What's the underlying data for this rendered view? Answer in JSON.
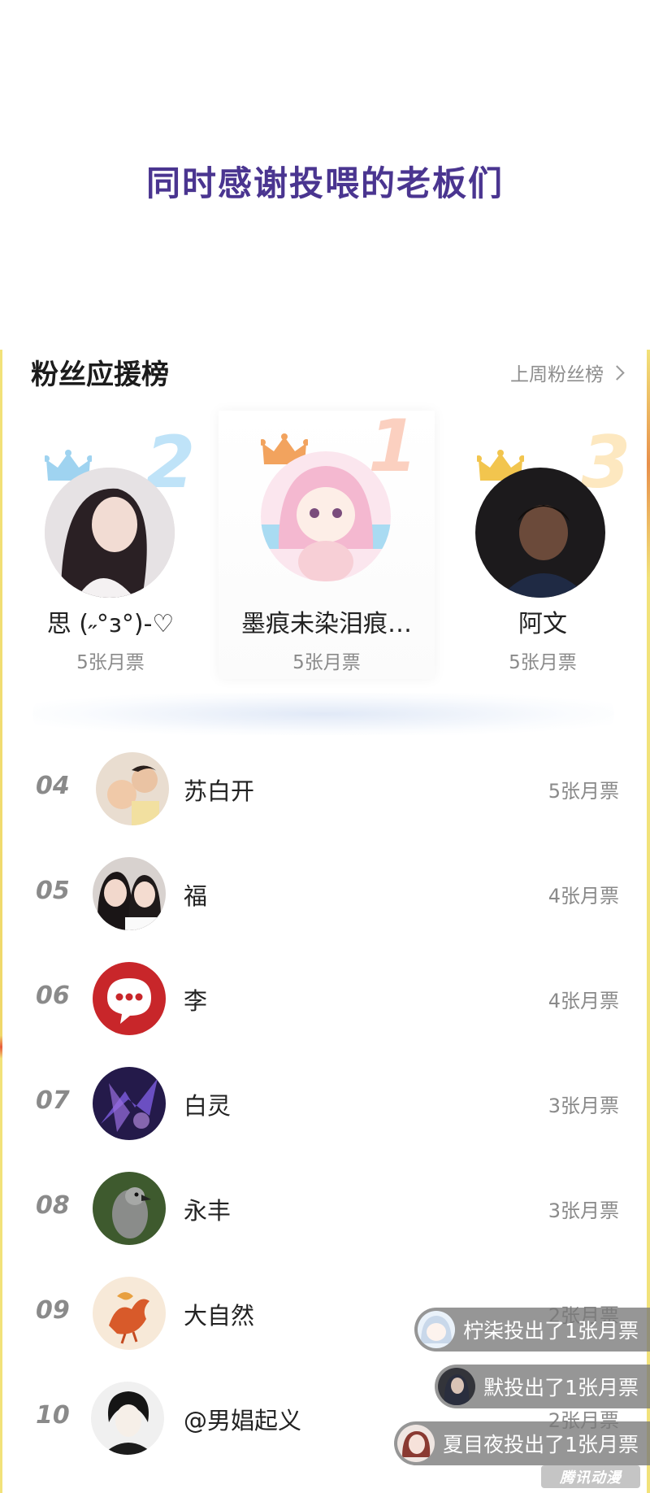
{
  "banner": {
    "title": "同时感谢投喂的老板们"
  },
  "ranking": {
    "title": "粉丝应援榜",
    "last_week_label": "上周粉丝榜",
    "top3": [
      {
        "rank": "2",
        "name": "思 (˶°з°)-♡",
        "votes": "5张月票",
        "crown_color": "#9fd3f0",
        "num_color": "#bfe3f8"
      },
      {
        "rank": "1",
        "name": "墨痕未染泪痕…",
        "votes": "5张月票",
        "crown_color": "#f2a35e",
        "num_color": "#fbd0c0"
      },
      {
        "rank": "3",
        "name": "阿文",
        "votes": "5张月票",
        "crown_color": "#f2c54e",
        "num_color": "#fde8c0"
      }
    ],
    "list": [
      {
        "rank": "04",
        "name": "苏白开",
        "votes": "5张月票"
      },
      {
        "rank": "05",
        "name": "福",
        "votes": "4张月票"
      },
      {
        "rank": "06",
        "name": "李",
        "votes": "4张月票"
      },
      {
        "rank": "07",
        "name": "白灵",
        "votes": "3张月票"
      },
      {
        "rank": "08",
        "name": "永丰",
        "votes": "3张月票"
      },
      {
        "rank": "09",
        "name": "大自然",
        "votes": "2张月票"
      },
      {
        "rank": "10",
        "name": "@男娼起义",
        "votes": "2张月票"
      }
    ]
  },
  "toasts": [
    {
      "text": "柠柒投出了1张月票"
    },
    {
      "text": "默投出了1张月票"
    },
    {
      "text": "夏目夜投出了1张月票"
    }
  ],
  "watermark": "腾讯动漫"
}
